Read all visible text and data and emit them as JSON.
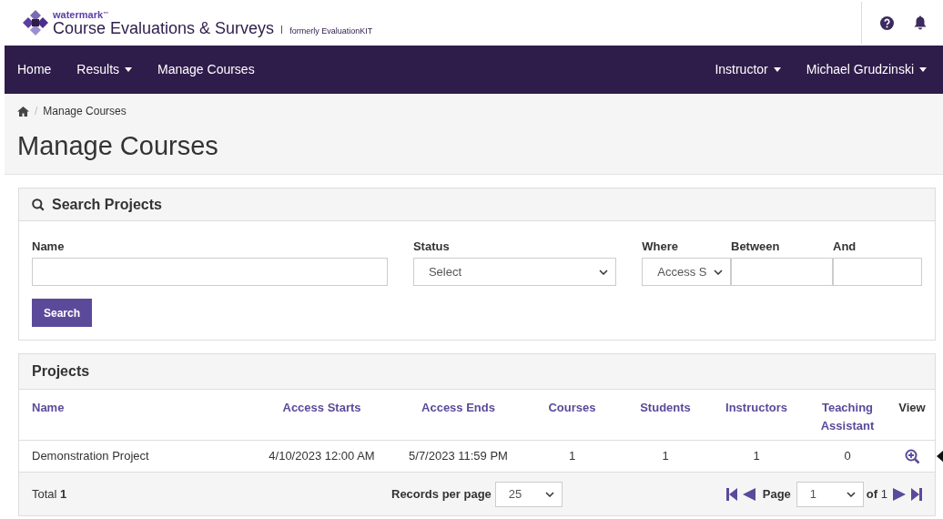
{
  "brand": {
    "small": "watermark",
    "trademark": "™",
    "title": "Course Evaluations & Surveys",
    "note": "formerly EvaluationKIT"
  },
  "nav": {
    "left": [
      {
        "label": "Home",
        "dropdown": false
      },
      {
        "label": "Results",
        "dropdown": true
      },
      {
        "label": "Manage Courses",
        "dropdown": false
      }
    ],
    "right": [
      {
        "label": "Instructor",
        "dropdown": true
      },
      {
        "label": "Michael Grudzinski",
        "dropdown": true
      }
    ]
  },
  "breadcrumb": [
    {
      "separator": "/",
      "label": "Manage Courses"
    }
  ],
  "page_title": "Manage Courses",
  "search": {
    "title": "Search Projects",
    "fields": [
      {
        "kind": "text",
        "label": "Name"
      },
      {
        "kind": "select",
        "label": "Status",
        "value": "Select"
      },
      {
        "kind": "select",
        "label": "Where",
        "value": "Access S"
      },
      {
        "kind": "text",
        "label": "Between"
      },
      {
        "kind": "text",
        "label": "And"
      }
    ],
    "button": "Search"
  },
  "projects": {
    "title": "Projects",
    "columns": [
      "Name",
      "Access Starts",
      "Access Ends",
      "Courses",
      "Students",
      "Instructors",
      "Teaching Assistant",
      "View"
    ],
    "rows": [
      {
        "cells": [
          "Demonstration Project",
          "4/10/2023 12:00 AM",
          "5/7/2023 11:59 PM",
          "1",
          "1",
          "1",
          "0"
        ]
      }
    ],
    "total_label": "Total",
    "total": "1",
    "records_label": "Records per page",
    "records": "25",
    "page_label": "Page",
    "page": "1",
    "of_label": "of",
    "of": "1"
  }
}
